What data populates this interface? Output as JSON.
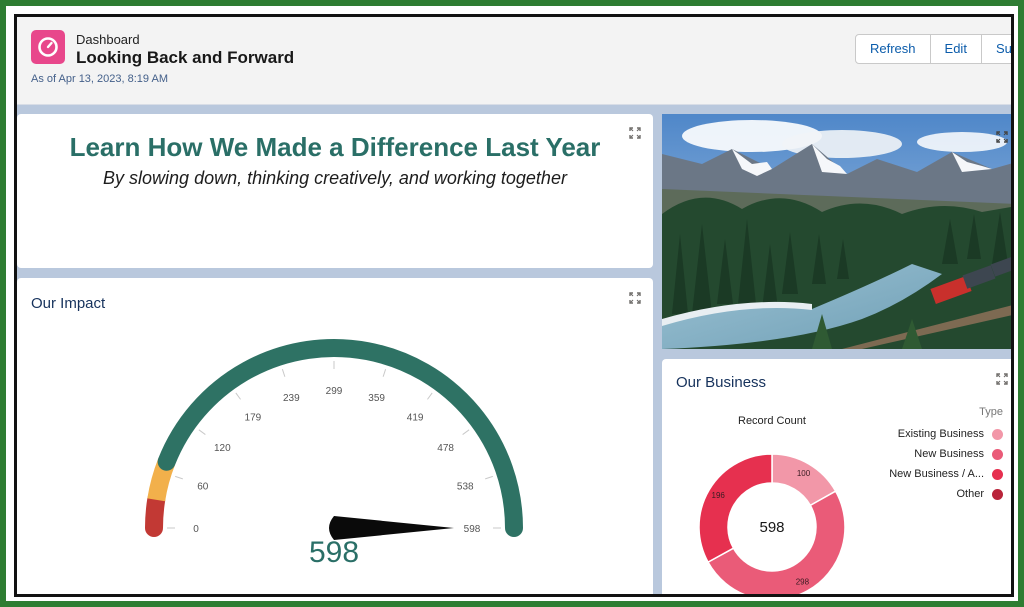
{
  "header": {
    "eyebrow": "Dashboard",
    "title": "Looking Back and Forward",
    "as_of": "As of Apr 13, 2023, 8:19 AM",
    "buttons": [
      "Refresh",
      "Edit",
      "Sub"
    ]
  },
  "banner": {
    "heading": "Learn How We Made a Difference Last Year",
    "subheading": "By slowing down, thinking creatively, and working together"
  },
  "impact": {
    "title": "Our Impact",
    "value": "598",
    "ticks": [
      "0",
      "60",
      "120",
      "179",
      "239",
      "299",
      "359",
      "419",
      "478",
      "538",
      "598"
    ],
    "gauge_min": 0,
    "gauge_max": 598,
    "gauge_value": 598,
    "colors": {
      "red": "#c23934",
      "yellow": "#f2b04b",
      "green": "#2e7264",
      "needle": "#0a0a0a"
    }
  },
  "business": {
    "title": "Our Business",
    "chart_label": "Record Count",
    "total": "598",
    "legend_title": "Type",
    "legend": [
      {
        "label": "Existing Business",
        "color": "#f297a8"
      },
      {
        "label": "New Business",
        "color": "#ea5b78"
      },
      {
        "label": "New Business / A...",
        "color": "#e6304f"
      },
      {
        "label": "Other",
        "color": "#b9243a"
      }
    ]
  },
  "chart_data": {
    "type": "pie",
    "title": "Record Count",
    "categories": [
      "Existing Business",
      "New Business",
      "New Business / A..."
    ],
    "values": [
      100,
      298,
      196
    ],
    "colors": [
      "#f297a8",
      "#ea5b78",
      "#e6304f"
    ],
    "center_label": "598"
  }
}
